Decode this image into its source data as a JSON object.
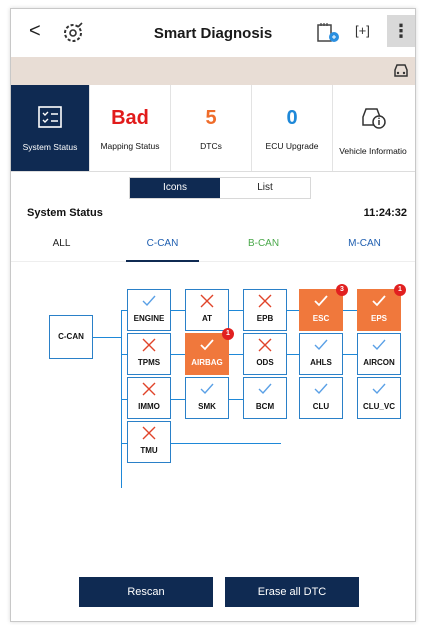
{
  "header": {
    "back": "<",
    "title": "Smart Diagnosis",
    "capture": "[+]",
    "more": "⋮"
  },
  "cards": [
    {
      "value": "",
      "label": "System Status"
    },
    {
      "value": "Bad",
      "label": "Mapping Status"
    },
    {
      "value": "5",
      "label": "DTCs"
    },
    {
      "value": "0",
      "label": "ECU Upgrade"
    },
    {
      "value": "",
      "label": "Vehicle Informatio"
    }
  ],
  "view_toggle": {
    "icons": "Icons",
    "list": "List"
  },
  "section": {
    "title": "System Status",
    "time": "11:24:32"
  },
  "bus_tabs": [
    "ALL",
    "C-CAN",
    "B-CAN",
    "M-CAN"
  ],
  "root_node": "C-CAN",
  "ecus": [
    {
      "name": "ENGINE",
      "status": "ok",
      "badge": ""
    },
    {
      "name": "AT",
      "status": "fail",
      "badge": ""
    },
    {
      "name": "EPB",
      "status": "fail",
      "badge": ""
    },
    {
      "name": "ESC",
      "status": "warn",
      "badge": "3"
    },
    {
      "name": "EPS",
      "status": "warn",
      "badge": "1"
    },
    {
      "name": "TPMS",
      "status": "fail",
      "badge": ""
    },
    {
      "name": "AIRBAG",
      "status": "warn",
      "badge": "1"
    },
    {
      "name": "ODS",
      "status": "fail",
      "badge": ""
    },
    {
      "name": "AHLS",
      "status": "ok",
      "badge": ""
    },
    {
      "name": "AIRCON",
      "status": "ok",
      "badge": ""
    },
    {
      "name": "IMMO",
      "status": "fail",
      "badge": ""
    },
    {
      "name": "SMK",
      "status": "ok",
      "badge": ""
    },
    {
      "name": "BCM",
      "status": "ok",
      "badge": ""
    },
    {
      "name": "CLU",
      "status": "ok",
      "badge": ""
    },
    {
      "name": "CLU_VC",
      "status": "ok",
      "badge": ""
    },
    {
      "name": "TMU",
      "status": "fail",
      "badge": ""
    }
  ],
  "buttons": {
    "rescan": "Rescan",
    "erase": "Erase all DTC"
  },
  "colors": {
    "navy": "#0f2a52",
    "warn": "#f0783c",
    "ok": "#3a8ee0",
    "fail": "#e0442a"
  }
}
